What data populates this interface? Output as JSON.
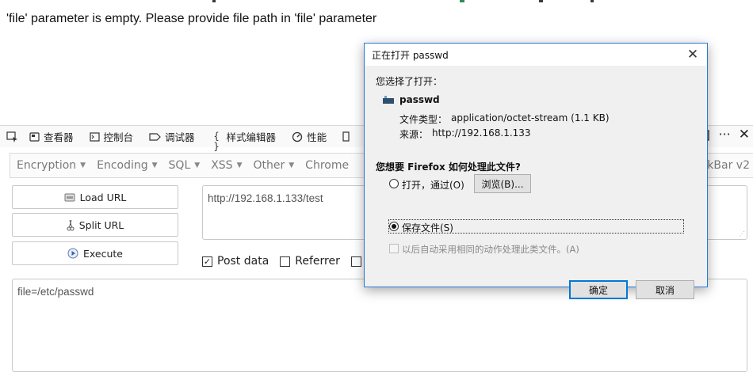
{
  "page": {
    "message": "'file' parameter is empty. Please provide file path in 'file' parameter"
  },
  "devtools": {
    "tabs": [
      {
        "icon": "inspector-icon",
        "label": "查看器"
      },
      {
        "icon": "console-icon",
        "label": "控制台"
      },
      {
        "icon": "debugger-icon",
        "label": "调试器"
      },
      {
        "icon": "braces-icon",
        "label": "样式编辑器"
      },
      {
        "icon": "performance-icon",
        "label": "性能"
      }
    ]
  },
  "hackbar": {
    "menu": [
      "Encryption",
      "Encoding",
      "SQL",
      "XSS",
      "Other",
      "Chrome"
    ],
    "menu_right": "kBar v2",
    "load_url": "Load URL",
    "split_url": "Split URL",
    "execute": "Execute",
    "url_value": "http://192.168.1.133/test",
    "post_data_label": "Post data",
    "referrer_label": "Referrer",
    "post_value": "file=/etc/passwd"
  },
  "dialog": {
    "title": "正在打开 passwd",
    "you_chose": "您选择了打开：",
    "filename": "passwd",
    "type_label": "文件类型：",
    "type_value": "application/octet-stream (1.1 KB)",
    "source_label": "来源：",
    "source_value": "http://192.168.1.133",
    "question": "您想要 Firefox 如何处理此文件?",
    "open_with": "打开，通过(O)",
    "browse": "浏览(B)...",
    "save_file": "保存文件(S)",
    "auto_label": "以后自动采用相同的动作处理此类文件。(A)",
    "ok": "确定",
    "cancel": "取消"
  }
}
